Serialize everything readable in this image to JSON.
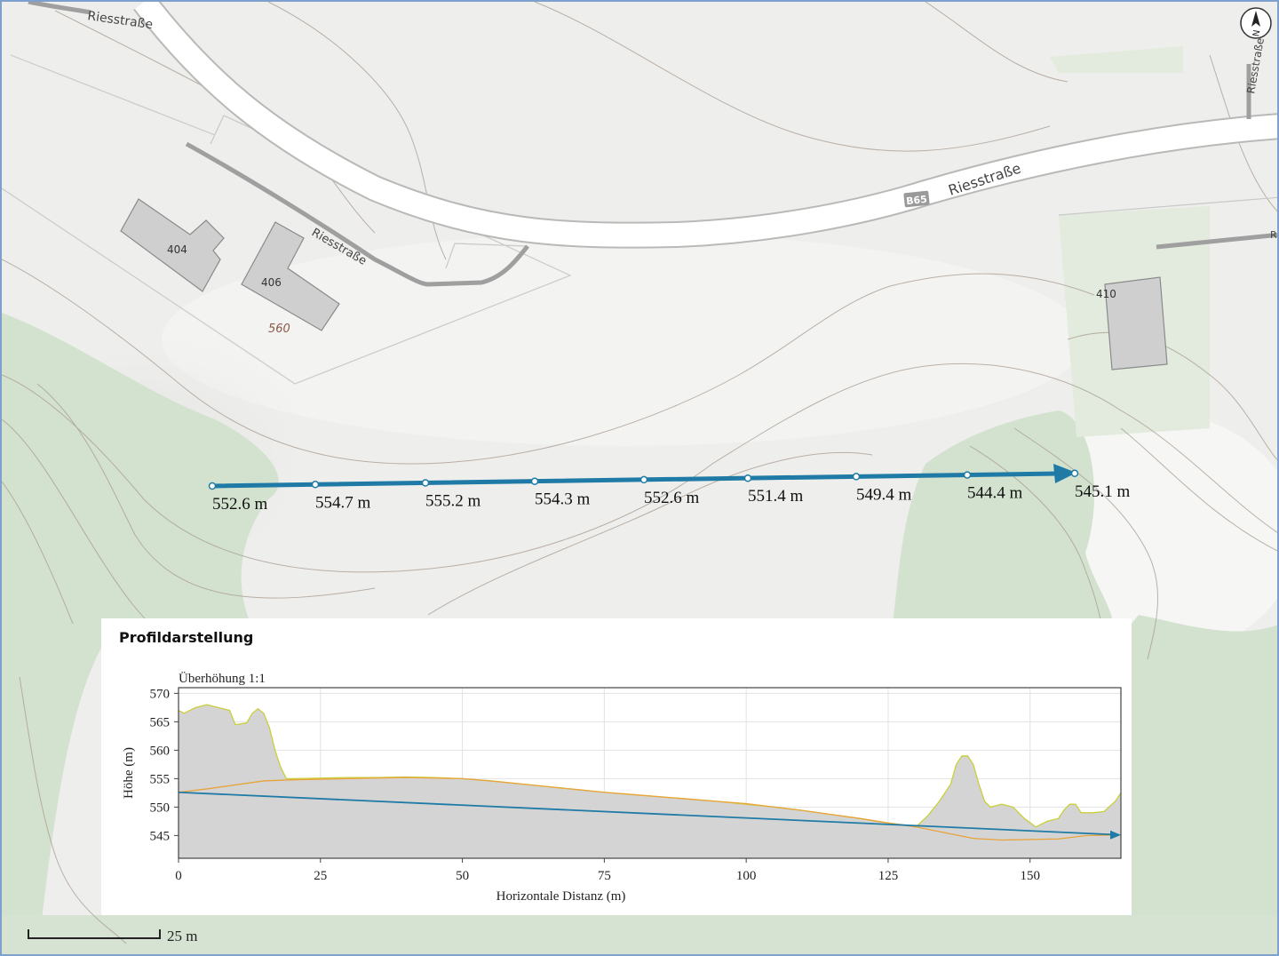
{
  "map": {
    "streets": {
      "riesstrasse_a": "Riesstraße",
      "riesstrasse_b": "Riesstraße",
      "riesstrasse_c": "Riesstraße",
      "riesstrasse_d": "Riesstraße",
      "road_badge": "B65"
    },
    "buildings": {
      "b404": "404",
      "b406": "406",
      "b410": "410"
    },
    "contour_label": "560",
    "north_label": "N",
    "scale_label": "25 m",
    "edge_label": "R"
  },
  "measure_points": [
    {
      "label": "552.6 m"
    },
    {
      "label": "554.7 m"
    },
    {
      "label": "555.2 m"
    },
    {
      "label": "554.3 m"
    },
    {
      "label": "552.6 m"
    },
    {
      "label": "551.4 m"
    },
    {
      "label": "549.4 m"
    },
    {
      "label": "544.4 m"
    },
    {
      "label": "545.1 m"
    }
  ],
  "colors": {
    "line": "#1f7ba6",
    "terrain_fill": "#d4d4d4",
    "terrain_stroke": "#c9cf3a",
    "ground_line": "#e8a33a",
    "forest": "#cfdfcc",
    "contour": "#a89a8e"
  },
  "panel": {
    "title": "Profildarstellung"
  },
  "chart_data": {
    "type": "area",
    "title": "Profildarstellung",
    "subtitle": "Überhöhung 1:1",
    "xlabel": "Horizontale Distanz (m)",
    "ylabel": "Höhe (m)",
    "xlim": [
      0,
      166
    ],
    "ylim": [
      541,
      571
    ],
    "xticks": [
      0,
      25,
      50,
      75,
      100,
      125,
      150
    ],
    "yticks": [
      545,
      550,
      555,
      560,
      565,
      570
    ],
    "grid": true,
    "series": [
      {
        "kind": "terrain",
        "x": [
          0,
          1,
          3,
          5,
          7,
          9,
          10,
          12,
          13,
          14,
          15,
          16,
          17,
          18,
          19,
          20,
          25,
          30,
          35,
          40,
          45,
          50,
          55,
          60,
          65,
          70,
          75,
          80,
          85,
          90,
          95,
          100,
          105,
          110,
          115,
          120,
          125,
          130,
          132,
          134,
          136,
          137,
          138,
          139,
          140,
          141,
          142,
          143,
          145,
          147,
          149,
          151,
          153,
          155,
          156,
          157,
          158,
          159,
          161,
          163,
          165,
          166
        ],
        "y": [
          567,
          566.5,
          567.5,
          568,
          567.5,
          567,
          564.5,
          564.8,
          566.5,
          567.3,
          566.5,
          564,
          560,
          557,
          555,
          555,
          555.1,
          555.2,
          555.2,
          555.3,
          555.2,
          555,
          554.6,
          554.1,
          553.6,
          553.1,
          552.6,
          552.2,
          551.8,
          551.4,
          551,
          550.5,
          550,
          549.4,
          548.7,
          548,
          547.2,
          546.6,
          548.5,
          551,
          554,
          557.5,
          559,
          559,
          557.5,
          554,
          551,
          550,
          550.5,
          550,
          548,
          546.5,
          547.5,
          548,
          549.5,
          550.5,
          550.5,
          549,
          549,
          549.2,
          551,
          552.5
        ]
      },
      {
        "kind": "ground",
        "x": [
          0,
          5,
          10,
          15,
          20,
          25,
          30,
          35,
          40,
          45,
          50,
          55,
          60,
          65,
          70,
          75,
          80,
          85,
          90,
          95,
          100,
          105,
          110,
          115,
          120,
          125,
          130,
          135,
          140,
          145,
          150,
          155,
          160,
          166
        ],
        "y": [
          552.6,
          553.2,
          553.9,
          554.6,
          554.8,
          554.9,
          555,
          555.1,
          555.2,
          555.1,
          555,
          554.6,
          554.1,
          553.6,
          553.1,
          552.6,
          552.2,
          551.8,
          551.4,
          551,
          550.6,
          550,
          549.4,
          548.7,
          548,
          547.2,
          546.5,
          545.5,
          544.5,
          544.2,
          544.3,
          544.4,
          545,
          545.1
        ]
      },
      {
        "kind": "line",
        "x": [
          0,
          166
        ],
        "y": [
          552.6,
          545.1
        ]
      }
    ]
  }
}
